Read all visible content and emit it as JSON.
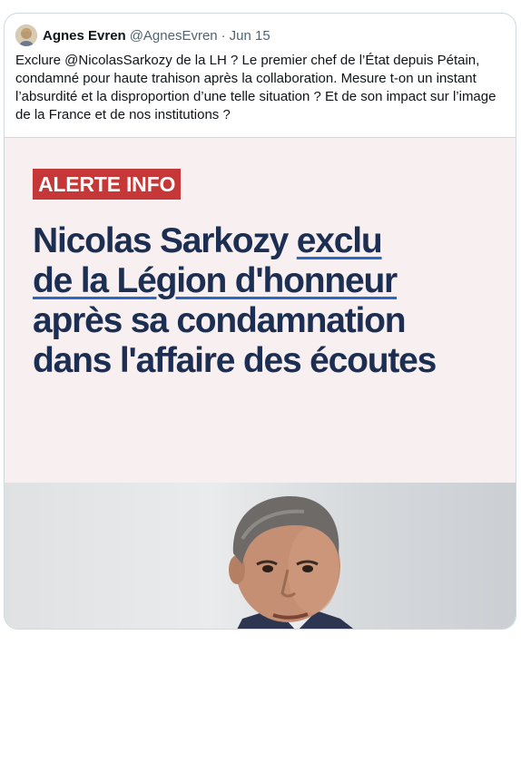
{
  "tweet": {
    "author_name": "Agnes Evren",
    "author_handle": "@AgnesEvren",
    "separator": "·",
    "date": "Jun 15",
    "text": "Exclure @NicolasSarkozy de la LH ? Le premier chef de l’État depuis Pétain, condamné pour haute trahison après la collaboration. Mesure t-on un instant l’absurdité et la disproportion d’une telle situation ? Et de son impact sur l’image de la France et de nos institutions ?"
  },
  "media": {
    "badge": "ALERTE INFO",
    "headline": {
      "part1": "Nicolas Sarkozy ",
      "part2_underlined": "exclu",
      "part3_underlined": "de la Légion d'honneur",
      "part4": "après sa condamnation",
      "part5": "dans l'affaire des écoutes"
    },
    "colors": {
      "badge_bg": "#c63737",
      "headline": "#1c2f53",
      "underline": "#2a66c4",
      "banner_bg": "#f8eff0"
    }
  }
}
